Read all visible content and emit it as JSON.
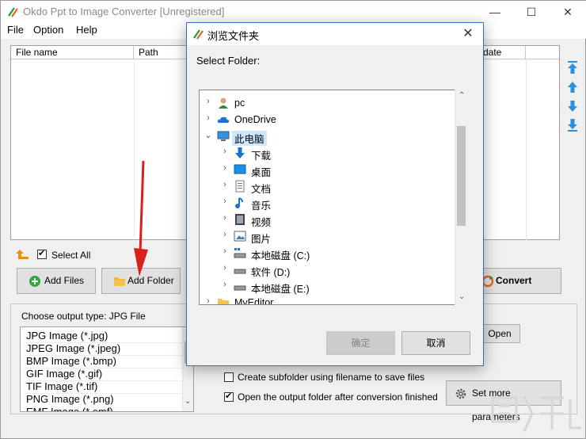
{
  "window": {
    "title": "Okdo Ppt to Image Converter [Unregistered]",
    "minimize": "—",
    "maximize": "☐",
    "close": "✕"
  },
  "menu": [
    "File",
    "Option",
    "Help"
  ],
  "file_list": {
    "columns": [
      "File name",
      "Path",
      "date"
    ]
  },
  "select_all": {
    "label": "Select All",
    "checked": true
  },
  "buttons": {
    "add_files": "Add Files",
    "add_folder": "Add Folder",
    "convert": "Convert",
    "open": "Open",
    "set_more": "Set more parameters"
  },
  "output": {
    "label": "Choose output type:  JPG File",
    "formats": [
      "JPG Image (*.jpg)",
      "JPEG Image (*.jpeg)",
      "BMP Image (*.bmp)",
      "GIF Image (*.gif)",
      "TIF Image (*.tif)",
      "PNG Image (*.png)",
      "EMF Image (*.emf)"
    ],
    "options": [
      {
        "label": "Create subfolder using filename to save files",
        "checked": false
      },
      {
        "label": "Open the output folder after conversion finished",
        "checked": true
      }
    ]
  },
  "dialog": {
    "title": "浏览文件夹",
    "close": "✕",
    "prompt": "Select Folder:",
    "tree": [
      {
        "label": "pc",
        "icon": "user-icon",
        "level": 0,
        "expanded": false
      },
      {
        "label": "OneDrive",
        "icon": "cloud-icon",
        "level": 0,
        "expanded": false
      },
      {
        "label": "此电脑",
        "icon": "computer-icon",
        "level": 0,
        "expanded": true,
        "selected": true
      },
      {
        "label": "下载",
        "icon": "download-folder-icon",
        "level": 1,
        "expanded": false
      },
      {
        "label": "桌面",
        "icon": "desktop-folder-icon",
        "level": 1,
        "expanded": false
      },
      {
        "label": "文档",
        "icon": "documents-folder-icon",
        "level": 1,
        "expanded": false
      },
      {
        "label": "音乐",
        "icon": "music-folder-icon",
        "level": 1,
        "expanded": false
      },
      {
        "label": "视频",
        "icon": "video-folder-icon",
        "level": 1,
        "expanded": false
      },
      {
        "label": "图片",
        "icon": "pictures-folder-icon",
        "level": 1,
        "expanded": false
      },
      {
        "label": "本地磁盘 (C:)",
        "icon": "system-drive-icon",
        "level": 1,
        "expanded": false
      },
      {
        "label": "软件 (D:)",
        "icon": "drive-icon",
        "level": 1,
        "expanded": false
      },
      {
        "label": "本地磁盘 (E:)",
        "icon": "drive-icon",
        "level": 1,
        "expanded": false
      },
      {
        "label": "MyEditor",
        "icon": "folder-icon",
        "level": 0,
        "expanded": false
      }
    ],
    "ok": "确定",
    "cancel": "取消"
  },
  "colors": {
    "accent": "#2f72c4",
    "selection": "#cce8ff",
    "annotation_arrow": "#d9201c"
  }
}
